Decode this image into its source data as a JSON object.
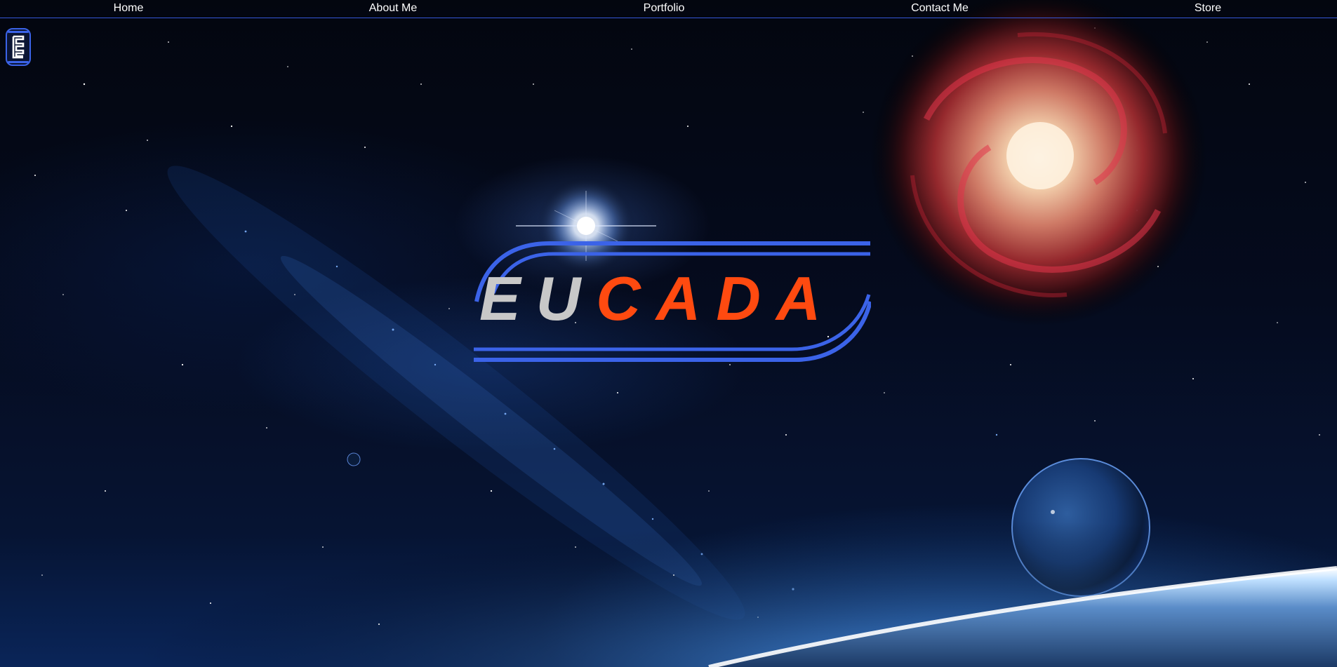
{
  "nav": {
    "items": [
      {
        "label": "Home"
      },
      {
        "label": "About Me"
      },
      {
        "label": "Portfolio"
      },
      {
        "label": "Contact Me"
      },
      {
        "label": "Store"
      }
    ]
  },
  "logo": {
    "icon": "eucada-monogram-icon",
    "brand_part_1": "EU",
    "brand_part_2": "CADA"
  },
  "colors": {
    "accent_blue": "#3b63e8",
    "brand_orange": "#ff4a10",
    "brand_gray": "#c8c8c8",
    "nav_text": "#ffffff"
  }
}
